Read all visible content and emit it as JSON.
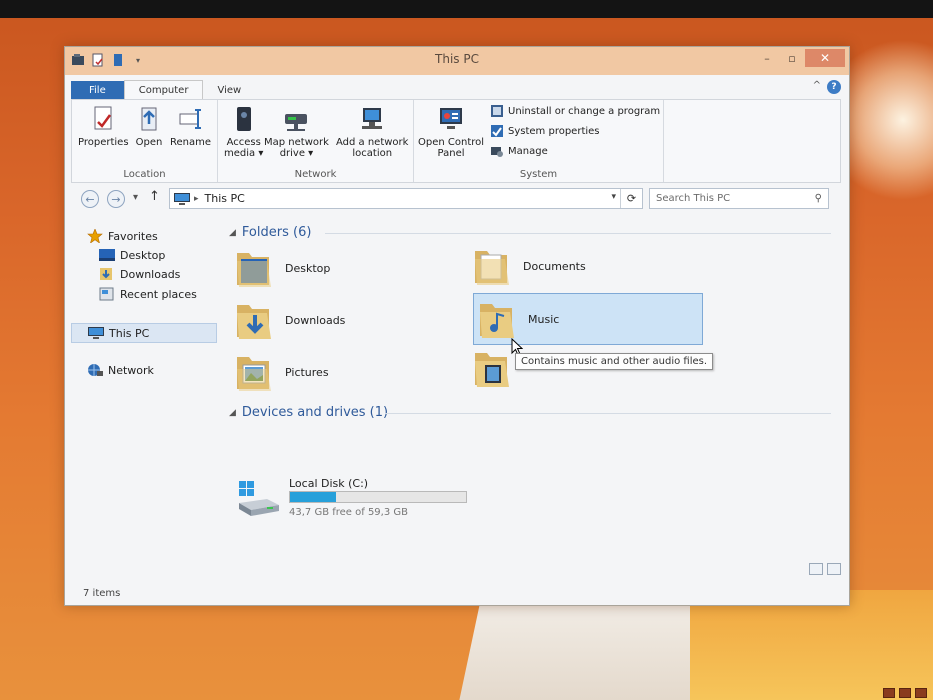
{
  "window": {
    "title": "This PC"
  },
  "ribbon": {
    "tabs": [
      {
        "label": "File"
      },
      {
        "label": "Computer"
      },
      {
        "label": "View"
      }
    ],
    "location": {
      "label": "Location",
      "properties": "Properties",
      "open": "Open",
      "rename": "Rename"
    },
    "network": {
      "label": "Network",
      "access_media_1": "Access",
      "access_media_2": "media ▾",
      "map_drive_1": "Map network",
      "map_drive_2": "drive ▾",
      "add_location_1": "Add a network",
      "add_location_2": "location"
    },
    "system": {
      "label": "System",
      "control_panel_1": "Open Control",
      "control_panel_2": "Panel",
      "uninstall": "Uninstall or change a program",
      "properties": "System properties",
      "manage": "Manage"
    }
  },
  "address": {
    "path": "This PC",
    "search_placeholder": "Search This PC"
  },
  "navpane": {
    "favorites": "Favorites",
    "desktop": "Desktop",
    "downloads": "Downloads",
    "recent": "Recent places",
    "this_pc": "This PC",
    "network": "Network"
  },
  "content": {
    "folders_header": "Folders (6)",
    "folders": [
      {
        "name": "Desktop"
      },
      {
        "name": "Documents"
      },
      {
        "name": "Downloads"
      },
      {
        "name": "Music"
      },
      {
        "name": "Pictures"
      },
      {
        "name": ""
      }
    ],
    "tooltip": "Contains music and other audio files.",
    "devices_header": "Devices and drives (1)",
    "drive": {
      "name": "Local Disk (C:)",
      "free": "43,7 GB free of 59,3 GB",
      "used_fraction": 0.263
    }
  },
  "status": {
    "items": "7 items"
  },
  "colors": {
    "accent": "#2f6cb4",
    "drive_bar": "#26a0da",
    "title_bar": "#f1c8a3"
  }
}
